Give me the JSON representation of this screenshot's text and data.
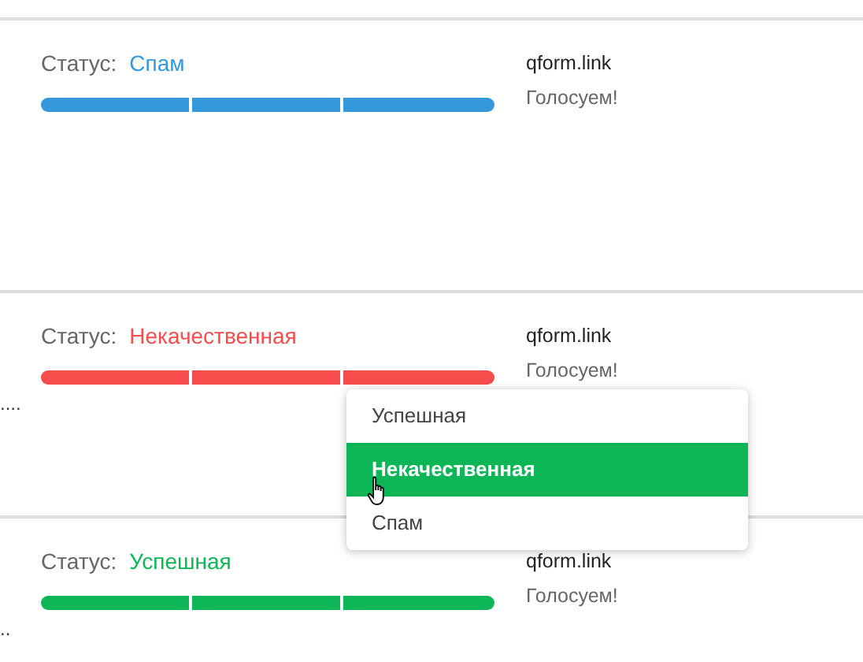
{
  "cards": [
    {
      "status_label": "Статус:",
      "status": "Спам",
      "color": "#3498db",
      "site": "qform.link",
      "message": "Голосуем!"
    },
    {
      "status_label": "Статус:",
      "status": "Некачественная",
      "color": "#f64c4c",
      "site": "qform.link",
      "message": "Голосуем!",
      "note": "...."
    },
    {
      "status_label": "Статус:",
      "status": "Успешная",
      "color": "#0db657",
      "site": "qform.link",
      "message": "Голосуем!",
      "note": ".."
    }
  ],
  "dropdown": {
    "items": [
      {
        "label": "Успешная",
        "selected": false
      },
      {
        "label": "Некачественная",
        "selected": true
      },
      {
        "label": "Спам",
        "selected": false
      }
    ]
  }
}
